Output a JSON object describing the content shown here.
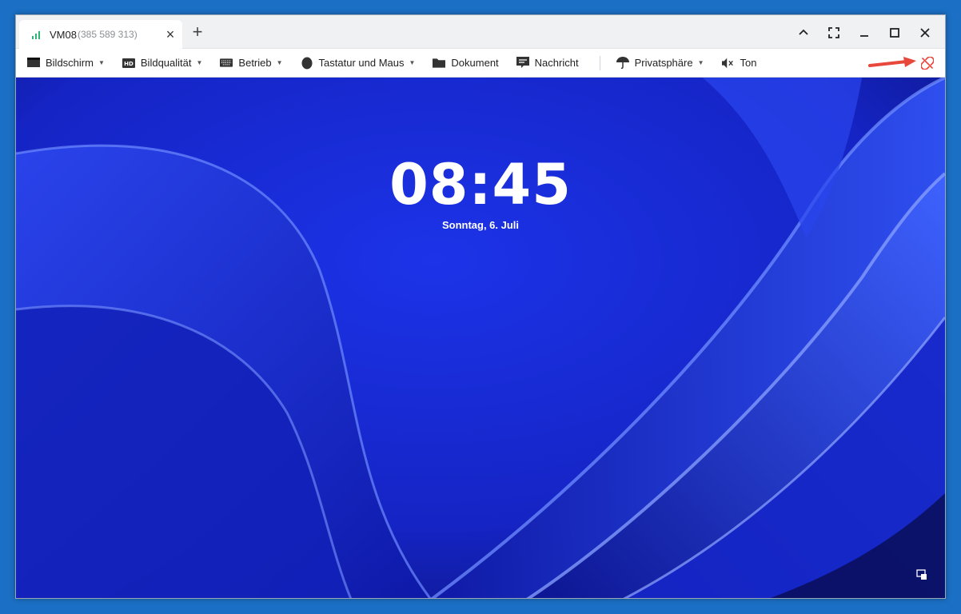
{
  "tab": {
    "title": "VM08",
    "id": "(385 589 313)",
    "close_glyph": "×",
    "new_tab_glyph": "+"
  },
  "window_controls": [
    "chevron-up-icon",
    "fullscreen-icon",
    "minimize-icon",
    "maximize-icon",
    "close-icon"
  ],
  "toolbar": {
    "items": [
      {
        "label": "Bildschirm",
        "icon": "monitor-icon",
        "dropdown": true
      },
      {
        "label": "Bildqualität",
        "icon": "hd-icon",
        "dropdown": true
      },
      {
        "label": "Betrieb",
        "icon": "keyboard-icon",
        "dropdown": true
      },
      {
        "label": "Tastatur und Maus",
        "icon": "mouse-icon",
        "dropdown": true
      },
      {
        "label": "Dokument",
        "icon": "folder-icon",
        "dropdown": false
      },
      {
        "label": "Nachricht",
        "icon": "message-icon",
        "dropdown": false
      },
      {
        "label": "Privatsphäre",
        "icon": "umbrella-icon",
        "dropdown": true
      },
      {
        "label": "Ton",
        "icon": "speaker-muted-icon",
        "dropdown": false
      }
    ],
    "caret_glyph": "▼",
    "disconnect_icon": "unlink-icon",
    "highlight_color": "#e8473b"
  },
  "lockscreen": {
    "time": "08:45",
    "date": "Sonntag, 6. Juli"
  },
  "colors": {
    "outer_background": "#1b6fc4",
    "wallpaper_base": "#1829d6",
    "signal": "#2bb673"
  }
}
